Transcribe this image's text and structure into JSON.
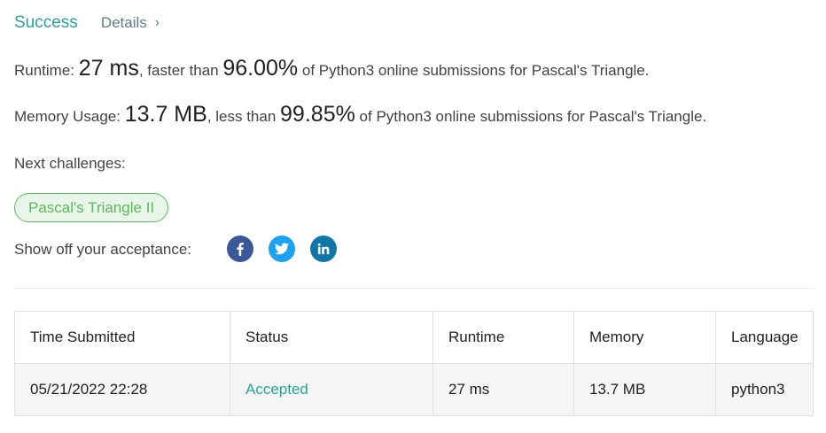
{
  "result": {
    "status": "Success",
    "details_label": "Details",
    "chevron": "›"
  },
  "runtime": {
    "prefix": "Runtime: ",
    "value": "27 ms",
    "middle": ", faster than ",
    "percent": "96.00%",
    "suffix": " of Python3 online submissions for Pascal's Triangle."
  },
  "memory": {
    "prefix": "Memory Usage: ",
    "value": "13.7 MB",
    "middle": ", less than ",
    "percent": "99.85%",
    "suffix": " of Python3 online submissions for Pascal's Triangle."
  },
  "next": {
    "label": "Next challenges:",
    "challenge": "Pascal's Triangle II"
  },
  "share": {
    "label": "Show off your acceptance:",
    "icons": [
      "facebook-icon",
      "twitter-icon",
      "linkedin-icon"
    ]
  },
  "table": {
    "headers": [
      "Time Submitted",
      "Status",
      "Runtime",
      "Memory",
      "Language"
    ],
    "rows": [
      [
        "05/21/2022 22:28",
        "Accepted",
        "27 ms",
        "13.7 MB",
        "python3"
      ]
    ]
  },
  "colors": {
    "accent": "#26a69a",
    "pill_green": "#5cb85c",
    "facebook": "#3b5998",
    "twitter": "#1da1f2",
    "linkedin": "#0e76a8"
  }
}
